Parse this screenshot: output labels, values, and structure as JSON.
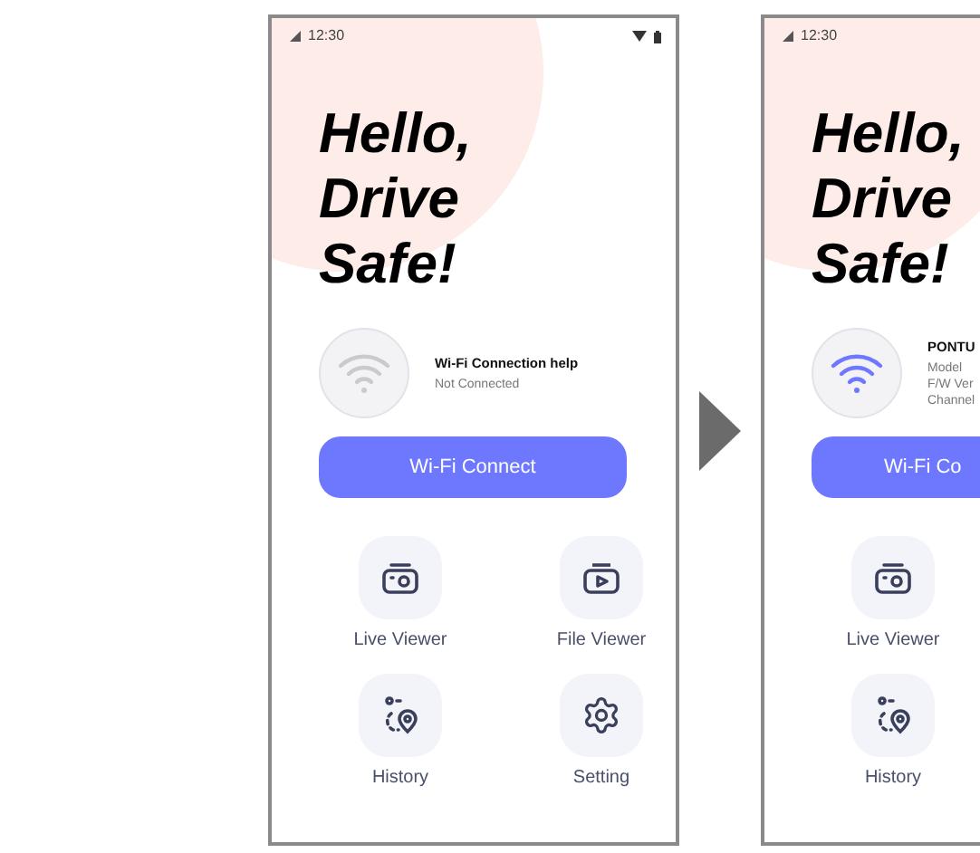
{
  "phones": [
    {
      "status_bar": {
        "time": "12:30"
      },
      "greeting": [
        "Hello,",
        "Drive",
        "Safe!"
      ],
      "wifi": {
        "connected": false,
        "info": [
          {
            "kind": "title",
            "text": "Wi-Fi Connection help"
          },
          {
            "kind": "line",
            "text": "Not Connected"
          }
        ]
      },
      "connect_button": "Wi-Fi Connect",
      "menu_rows": [
        [
          {
            "kind": "live",
            "label": "Live Viewer"
          },
          {
            "kind": "file",
            "label": "File Viewer"
          }
        ],
        [
          {
            "kind": "history",
            "label": "History"
          },
          {
            "kind": "setting",
            "label": "Setting"
          }
        ]
      ]
    },
    {
      "status_bar": {
        "time": "12:30"
      },
      "greeting": [
        "Hello,",
        "Drive",
        "Safe!"
      ],
      "wifi": {
        "connected": true,
        "info": [
          {
            "kind": "title",
            "text": "PONTU"
          },
          {
            "kind": "line",
            "text": "Model"
          },
          {
            "kind": "line",
            "text": "F/W Ver"
          },
          {
            "kind": "line",
            "text": "Channel"
          }
        ]
      },
      "connect_button": "Wi-Fi Co",
      "menu_rows": [
        [
          {
            "kind": "live",
            "label": "Live Viewer"
          }
        ],
        [
          {
            "kind": "history",
            "label": "History"
          }
        ]
      ]
    }
  ]
}
